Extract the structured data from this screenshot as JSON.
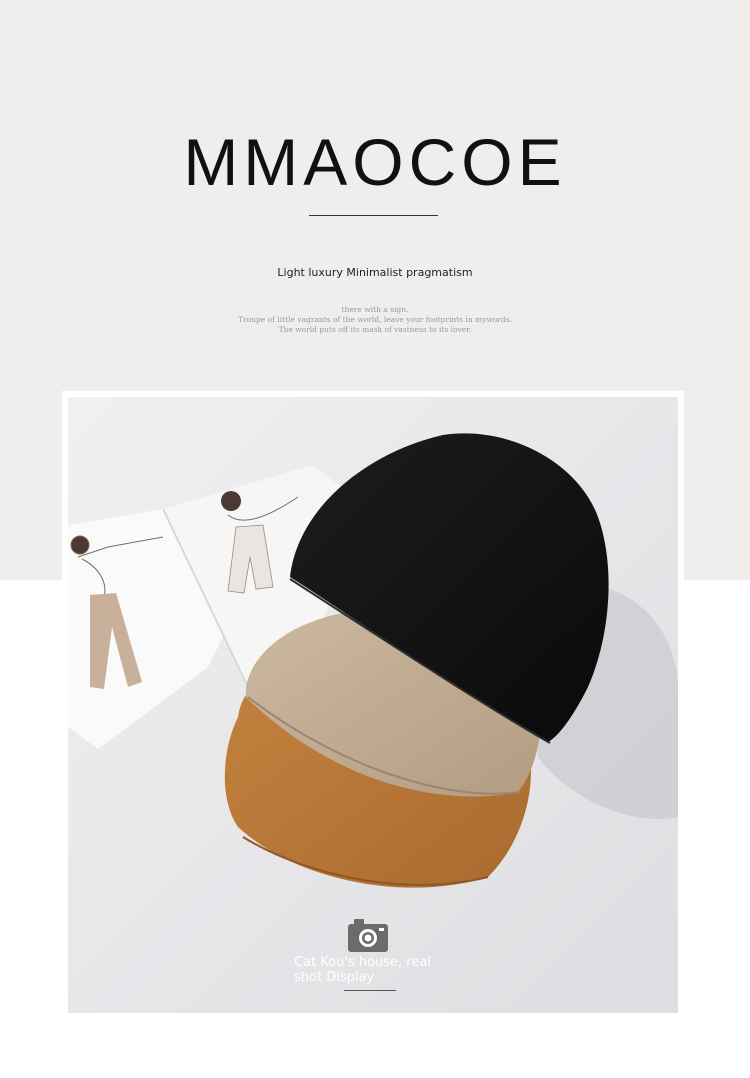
{
  "header": {
    "brand": "MMAOCOE",
    "tagline": "Light luxury Minimalist pragmatism",
    "poem_lines": [
      "there with a sign.",
      "Troupe of little vagrants of the world, leave your footprints in mywords.",
      "The world puts off its mask of vastness to its lover."
    ]
  },
  "photo": {
    "caption": "Cat Kou's house, real shot Display",
    "camera_icon": "camera-icon",
    "hat_colors": [
      "#121212",
      "#c2ad95",
      "#b9783c"
    ],
    "background_color": "#efeeec"
  }
}
